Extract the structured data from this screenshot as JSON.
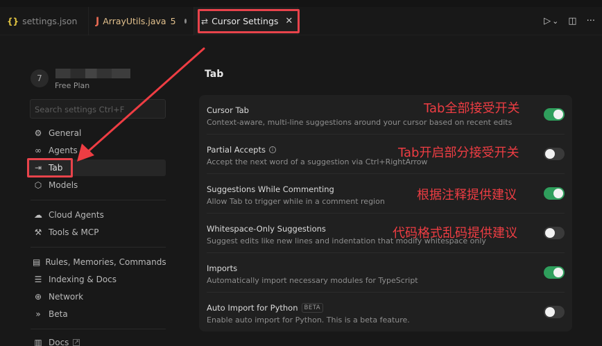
{
  "tabs": [
    {
      "icon": "{}",
      "label": "settings.json"
    },
    {
      "icon": "J",
      "label": "ArrayUtils.java",
      "count": "5"
    },
    {
      "icon": "⇄",
      "label": "Cursor Settings",
      "close": "✕"
    }
  ],
  "toolbar": {
    "run": "▷",
    "chev": "⌄",
    "split": "◫",
    "more": "···"
  },
  "user": {
    "initial": "7",
    "plan": "Free Plan"
  },
  "search": {
    "placeholder": "Search settings Ctrl+F"
  },
  "nav": {
    "general": "General",
    "agents": "Agents",
    "tab": "Tab",
    "models": "Models",
    "cloud_agents": "Cloud Agents",
    "tools_mcp": "Tools & MCP",
    "rules": "Rules, Memories, Commands",
    "indexing": "Indexing & Docs",
    "network": "Network",
    "beta": "Beta",
    "docs": "Docs"
  },
  "page": {
    "title": "Tab"
  },
  "settings": [
    {
      "title": "Cursor Tab",
      "desc": "Context-aware, multi-line suggestions around your cursor based on recent edits",
      "enabled": true
    },
    {
      "title": "Partial Accepts",
      "desc": "Accept the next word of a suggestion via Ctrl+RightArrow",
      "enabled": false
    },
    {
      "title": "Suggestions While Commenting",
      "desc": "Allow Tab to trigger while in a comment region",
      "enabled": true
    },
    {
      "title": "Whitespace-Only Suggestions",
      "desc": "Suggest edits like new lines and indentation that modify whitespace only",
      "enabled": false
    },
    {
      "title": "Imports",
      "desc": "Automatically import necessary modules for TypeScript",
      "enabled": true
    },
    {
      "title": "Auto Import for Python",
      "badge": "BETA",
      "desc": "Enable auto import for Python. This is a beta feature.",
      "enabled": false
    }
  ],
  "annotations": {
    "a1": "Tab全部接受开关",
    "a2": "Tab开启部分接受开关",
    "a3": "根据注释提供建议",
    "a4": "代码格式乱码提供建议"
  },
  "colors": {
    "annotation": "#ee3d43",
    "toggle_on": "#2f9e5c",
    "toggle_off": "#3a3a3a"
  }
}
